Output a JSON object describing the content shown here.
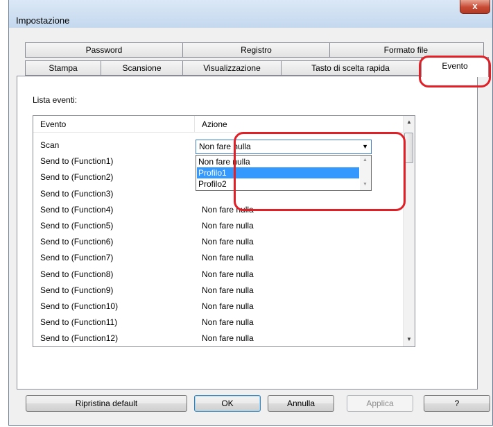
{
  "window": {
    "title": "Impostazione",
    "close_label": "x"
  },
  "tabs_row1": [
    "Password",
    "Registro",
    "Formato file"
  ],
  "tabs_row2": [
    "Stampa",
    "Scansione",
    "Visualizzazione",
    "Tasto di scelta rapida",
    "Evento"
  ],
  "active_tab": "Evento",
  "event_list": {
    "label": "Lista eventi:",
    "columns": [
      "Evento",
      "Azione"
    ],
    "rows": [
      {
        "event": "Scan",
        "action": "Non fare nulla"
      },
      {
        "event": "Send to (Function1)",
        "action": "Non fare nulla"
      },
      {
        "event": "Send to (Function2)",
        "action": "Non fare nulla"
      },
      {
        "event": "Send to (Function3)",
        "action": "Non fare nulla"
      },
      {
        "event": "Send to (Function4)",
        "action": "Non fare nulla"
      },
      {
        "event": "Send to (Function5)",
        "action": "Non fare nulla"
      },
      {
        "event": "Send to (Function6)",
        "action": "Non fare nulla"
      },
      {
        "event": "Send to (Function7)",
        "action": "Non fare nulla"
      },
      {
        "event": "Send to (Function8)",
        "action": "Non fare nulla"
      },
      {
        "event": "Send to (Function9)",
        "action": "Non fare nulla"
      },
      {
        "event": "Send to (Function10)",
        "action": "Non fare nulla"
      },
      {
        "event": "Send to (Function11)",
        "action": "Non fare nulla"
      },
      {
        "event": "Send to (Function12)",
        "action": "Non fare nulla"
      }
    ]
  },
  "combo": {
    "value": "Non fare nulla",
    "options": [
      "Non fare nulla",
      "Profilo1",
      "Profilo2"
    ],
    "highlighted": "Profilo1"
  },
  "buttons": {
    "reset": "Ripristina default",
    "ok": "OK",
    "cancel": "Annulla",
    "apply": "Applica",
    "help": "?"
  },
  "colors": {
    "highlight": "#e01f26",
    "selection": "#3399ff"
  }
}
